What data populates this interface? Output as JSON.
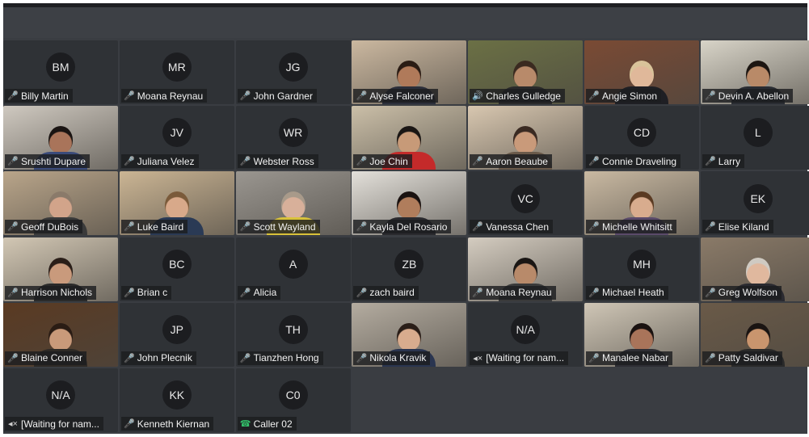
{
  "meeting": {
    "participants": [
      {
        "name": "Billy Martin",
        "initials": "BM",
        "video": false,
        "mic": "muted"
      },
      {
        "name": "Moana Reynau",
        "initials": "MR",
        "video": false,
        "mic": "muted"
      },
      {
        "name": "John Gardner",
        "initials": "JG",
        "video": false,
        "mic": "muted"
      },
      {
        "name": "Alyse Falconer",
        "initials": "",
        "video": true,
        "mic": "active",
        "scene": "#cbb8a0",
        "skin": "#b07a5a",
        "shirt": "#2c2f3a",
        "hair": "#2a1c14"
      },
      {
        "name": "Charles Gulledge",
        "initials": "",
        "video": true,
        "mic": "speaking",
        "scene": "#6b7045",
        "skin": "#b88a6a",
        "shirt": "#2a2a2a",
        "hair": "#3a2a20"
      },
      {
        "name": "Angie Simon",
        "initials": "",
        "video": true,
        "mic": "muted",
        "scene": "#7a4a34",
        "skin": "#e0b89a",
        "shirt": "#1f1f24",
        "hair": "#d9c39a"
      },
      {
        "name": "Devin A. Abellon",
        "initials": "",
        "video": true,
        "mic": "muted",
        "scene": "#d8d4c8",
        "skin": "#b98a68",
        "shirt": "#2a2d33",
        "hair": "#1c1612"
      },
      {
        "name": "Srushti Dupare",
        "initials": "",
        "video": true,
        "mic": "muted",
        "scene": "#cfc9c0",
        "skin": "#a9745a",
        "shirt": "#3a4a7a",
        "hair": "#1a1412"
      },
      {
        "name": "Juliana Velez",
        "initials": "JV",
        "video": false,
        "mic": "muted"
      },
      {
        "name": "Webster Ross",
        "initials": "WR",
        "video": false,
        "mic": "muted"
      },
      {
        "name": "Joe Chin",
        "initials": "",
        "video": true,
        "mic": "muted",
        "scene": "#cbbfa8",
        "skin": "#c79a78",
        "shirt": "#c42a2a",
        "hair": "#1a1614"
      },
      {
        "name": "Aaron Beaube",
        "initials": "",
        "video": true,
        "mic": "muted",
        "scene": "#d8c7b0",
        "skin": "#c99a7a",
        "shirt": "#6a5a4a",
        "hair": "#3a2a22"
      },
      {
        "name": "Connie Draveling",
        "initials": "CD",
        "video": false,
        "mic": "muted"
      },
      {
        "name": "Larry",
        "initials": "L",
        "video": false,
        "mic": "muted"
      },
      {
        "name": "Geoff  DuBois",
        "initials": "",
        "video": true,
        "mic": "muted",
        "scene": "#b9a58a",
        "skin": "#d2a48a",
        "shirt": "#3a3a3a",
        "hair": "#8a7a6a"
      },
      {
        "name": "Luke Baird",
        "initials": "",
        "video": true,
        "mic": "muted",
        "scene": "#cbb594",
        "skin": "#d8a98a",
        "shirt": "#2a3a55",
        "hair": "#7a5a3a"
      },
      {
        "name": "Scott Wayland",
        "initials": "",
        "video": true,
        "mic": "muted",
        "scene": "#9a9690",
        "skin": "#d8b09a",
        "shirt": "#d9c23a",
        "hair": "#a89a8a"
      },
      {
        "name": "Kayla Del Rosario",
        "initials": "",
        "video": true,
        "mic": "muted",
        "scene": "#e3e0da",
        "skin": "#b07d5c",
        "shirt": "#2a2a2e",
        "hair": "#1a1210"
      },
      {
        "name": "Vanessa Chen",
        "initials": "VC",
        "video": false,
        "mic": "muted"
      },
      {
        "name": "Michelle Whitsitt",
        "initials": "",
        "video": true,
        "mic": "muted",
        "scene": "#c9b9a2",
        "skin": "#d8ac8e",
        "shirt": "#5a4a6a",
        "hair": "#5a3a22"
      },
      {
        "name": "Elise Kiland",
        "initials": "EK",
        "video": false,
        "mic": "muted"
      },
      {
        "name": "Harrison Nichols",
        "initials": "",
        "video": true,
        "mic": "muted",
        "scene": "#d2c7b4",
        "skin": "#c99a7c",
        "shirt": "#2a2a2a",
        "hair": "#2a1e18"
      },
      {
        "name": "Brian c",
        "initials": "BC",
        "video": false,
        "mic": "muted"
      },
      {
        "name": "Alicia",
        "initials": "A",
        "video": false,
        "mic": "muted"
      },
      {
        "name": "zach baird",
        "initials": "ZB",
        "video": false,
        "mic": "muted"
      },
      {
        "name": "Moana Reynau",
        "initials": "",
        "video": true,
        "mic": "muted",
        "scene": "#d4ccc0",
        "skin": "#b88a6a",
        "shirt": "#3a3a3a",
        "hair": "#1a1614"
      },
      {
        "name": "Michael Heath",
        "initials": "MH",
        "video": false,
        "mic": "muted"
      },
      {
        "name": "Greg Wolfson",
        "initials": "",
        "video": true,
        "mic": "muted",
        "scene": "#8a7a68",
        "skin": "#e0b89e",
        "shirt": "#2a2a30",
        "hair": "#cfcac2"
      },
      {
        "name": "Blaine Conner",
        "initials": "",
        "video": true,
        "mic": "muted",
        "scene": "#5a3a22",
        "skin": "#c99a7a",
        "shirt": "#2e2a26",
        "hair": "#2a1c14"
      },
      {
        "name": "John Plecnik",
        "initials": "JP",
        "video": false,
        "mic": "muted"
      },
      {
        "name": "Tianzhen Hong",
        "initials": "TH",
        "video": false,
        "mic": "muted"
      },
      {
        "name": "Nikola Kravik",
        "initials": "",
        "video": true,
        "mic": "muted",
        "scene": "#b4aca0",
        "skin": "#d8ac8e",
        "shirt": "#2a3550",
        "hair": "#2a1e18"
      },
      {
        "name": "[Waiting for nam...",
        "initials": "N/A",
        "video": false,
        "mic": "audio"
      },
      {
        "name": "Manalee Nabar",
        "initials": "",
        "video": true,
        "mic": "muted",
        "scene": "#cfc6b6",
        "skin": "#a9745a",
        "shirt": "#2e2e34",
        "hair": "#1a1210"
      },
      {
        "name": "Patty Saldivar",
        "initials": "",
        "video": true,
        "mic": "muted",
        "scene": "#6a5a48",
        "skin": "#c9956e",
        "shirt": "#2a2a2a",
        "hair": "#1a1412"
      },
      {
        "name": "[Waiting for nam...",
        "initials": "N/A",
        "video": false,
        "mic": "audio"
      },
      {
        "name": "Kenneth Kiernan",
        "initials": "KK",
        "video": false,
        "mic": "muted"
      },
      {
        "name": "Caller 02",
        "initials": "C0",
        "video": false,
        "mic": "phone"
      }
    ]
  }
}
